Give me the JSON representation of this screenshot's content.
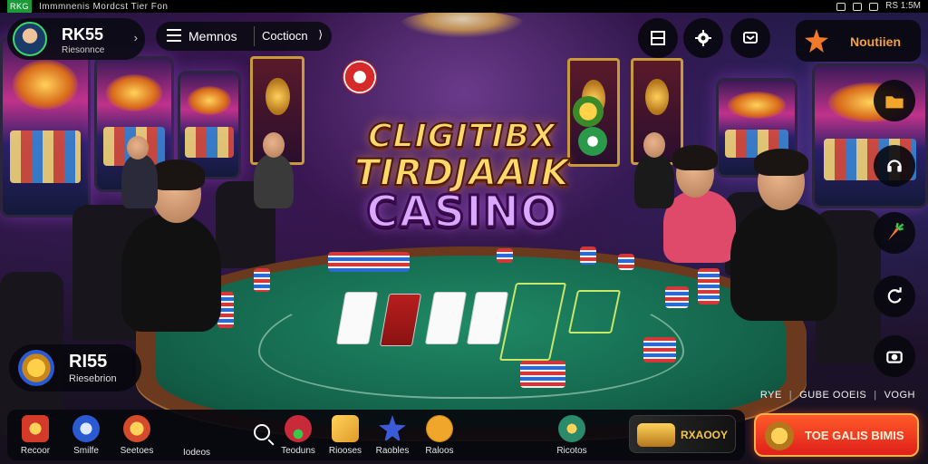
{
  "status_bar": {
    "carrier": "RKG",
    "left_text": "Immmnenis  Mordcst   Tier  Fon",
    "right_text": "RS 1:5M"
  },
  "profile": {
    "name": "RK55",
    "subtitle": "Riesonnce"
  },
  "menu": {
    "label": "Memnos",
    "selector": "Coctiocn"
  },
  "promo_top": {
    "label": "Noutiien"
  },
  "logo": {
    "line1": "CLIGITIBX",
    "line2": "TIRDJAAIK",
    "line3": "CASINO"
  },
  "wallet": {
    "value": "RI55",
    "subtitle": "Riesebrion"
  },
  "meta_row": {
    "item1": "RYE",
    "item2": "GUBE OOEIS",
    "item3": "VOGH"
  },
  "bottom_nav": {
    "items": [
      {
        "label": "Recoor",
        "icon": "poker-chip-icon",
        "color": "#d43a2a"
      },
      {
        "label": "Smilfe",
        "icon": "slot-machine-icon",
        "color": "#2a5ad2"
      },
      {
        "label": "Seetoes",
        "icon": "crown-chip-icon",
        "color": "#d44a2a"
      },
      {
        "label": "Iodeos",
        "icon": "",
        "color": ""
      },
      {
        "label": "Teoduns",
        "icon": "tulip-icon",
        "color": "#c82a3a"
      },
      {
        "label": "Riooses",
        "icon": "cards-icon",
        "color": "#e09a2a"
      },
      {
        "label": "Raobles",
        "icon": "star-icon",
        "color": "#3a5ad8"
      },
      {
        "label": "Raloos",
        "icon": "slash-coin-icon",
        "color": "#f0a62a"
      },
      {
        "label": "Ricotos",
        "icon": "globe-badge-icon",
        "color": "#2a8a6a"
      }
    ],
    "jackpot": "RXAOOY"
  },
  "cta": {
    "label": "TOE GALIS BIMIS"
  }
}
